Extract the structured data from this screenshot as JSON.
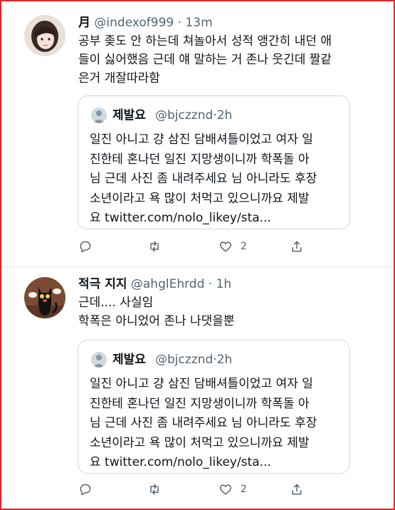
{
  "tweets": [
    {
      "name": "月",
      "handle": "@indexof999",
      "dot": "·",
      "time": "13m",
      "text": [
        "공부 좆도 안 하는데 쳐놀아서 성적 앵간히 내던 애",
        "들이 싫어했음 근데 얘 말하는 거 존나 웃긴데 짤같",
        "은거 개잘따라함"
      ],
      "quote": {
        "name": "제발요",
        "handle": "@bjczznd",
        "dot": "·",
        "time": "2h",
        "text": [
          "일진 아니고 걍 삼진 담배셔틀이었고 여자 일",
          "진한테 혼나던 일진 지망생이니까 학폭돌 아",
          "님 근데 사진 좀 내려주세요 님 아니라도 후장",
          "소년이라고 욕 많이 처먹고 있으니까요 제발",
          "요 twitter.com/nolo_likey/sta..."
        ]
      },
      "likes": "2"
    },
    {
      "name": "적극 지지",
      "handle": "@ahglEhrdd",
      "dot": "·",
      "time": "1h",
      "text": [
        "근데.... 사실임",
        "학폭은 아니었어 존나 나댓을뿐"
      ],
      "quote": {
        "name": "제발요",
        "handle": "@bjczznd",
        "dot": "·",
        "time": "2h",
        "text": [
          "일진 아니고 걍 삼진 담배셔틀이었고 여자 일",
          "진한테 혼나던 일진 지망생이니까 학폭돌 아",
          "님 근데 사진 좀 내려주세요 님 아니라도 후장",
          "소년이라고 욕 많이 처먹고 있으니까요 제발",
          "요 twitter.com/nolo_likey/sta..."
        ]
      },
      "likes": "2"
    }
  ],
  "colors": {
    "border": "#e3262b",
    "muted": "#536471",
    "text": "#0f1419"
  }
}
